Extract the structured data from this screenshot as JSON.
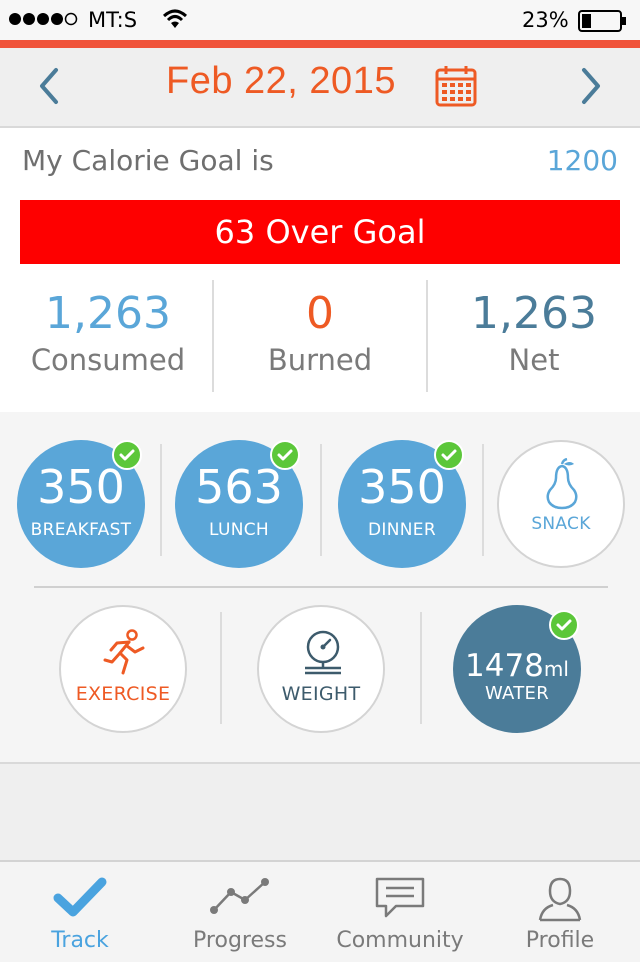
{
  "status_bar": {
    "carrier": "MT:S",
    "battery": "23%"
  },
  "header": {
    "date": "Feb 22, 2015"
  },
  "goal": {
    "label": "My Calorie Goal is",
    "value": "1200",
    "status": "63 Over Goal",
    "status_color": "#fe0000"
  },
  "stats": [
    {
      "value": "1,263",
      "label": "Consumed",
      "color": "#5aa6d8"
    },
    {
      "value": "0",
      "label": "Burned",
      "color": "#ee5a24"
    },
    {
      "value": "1,263",
      "label": "Net",
      "color": "#4b7c99"
    }
  ],
  "meals": [
    {
      "value": "350",
      "label": "BREAKFAST",
      "checked": true
    },
    {
      "value": "563",
      "label": "LUNCH",
      "checked": true
    },
    {
      "value": "350",
      "label": "DINNER",
      "checked": true
    },
    {
      "value": "",
      "label": "SNACK",
      "checked": false,
      "icon": "pear-icon"
    }
  ],
  "activities": [
    {
      "label": "EXERCISE",
      "icon": "running-man-icon"
    },
    {
      "label": "WEIGHT",
      "icon": "scale-icon"
    },
    {
      "value": "1478",
      "unit": "ml",
      "label": "WATER",
      "checked": true
    }
  ],
  "tabs": [
    {
      "label": "Track",
      "icon": "checkmark-icon",
      "active": true
    },
    {
      "label": "Progress",
      "icon": "line-graph-icon",
      "active": false
    },
    {
      "label": "Community",
      "icon": "chat-bubble-icon",
      "active": false
    },
    {
      "label": "Profile",
      "icon": "person-icon",
      "active": false
    }
  ],
  "colors": {
    "accent_orange": "#ee5a24",
    "accent_blue": "#5aa6d8",
    "water_blue": "#4b7c99",
    "check_green": "#5cc73a"
  }
}
